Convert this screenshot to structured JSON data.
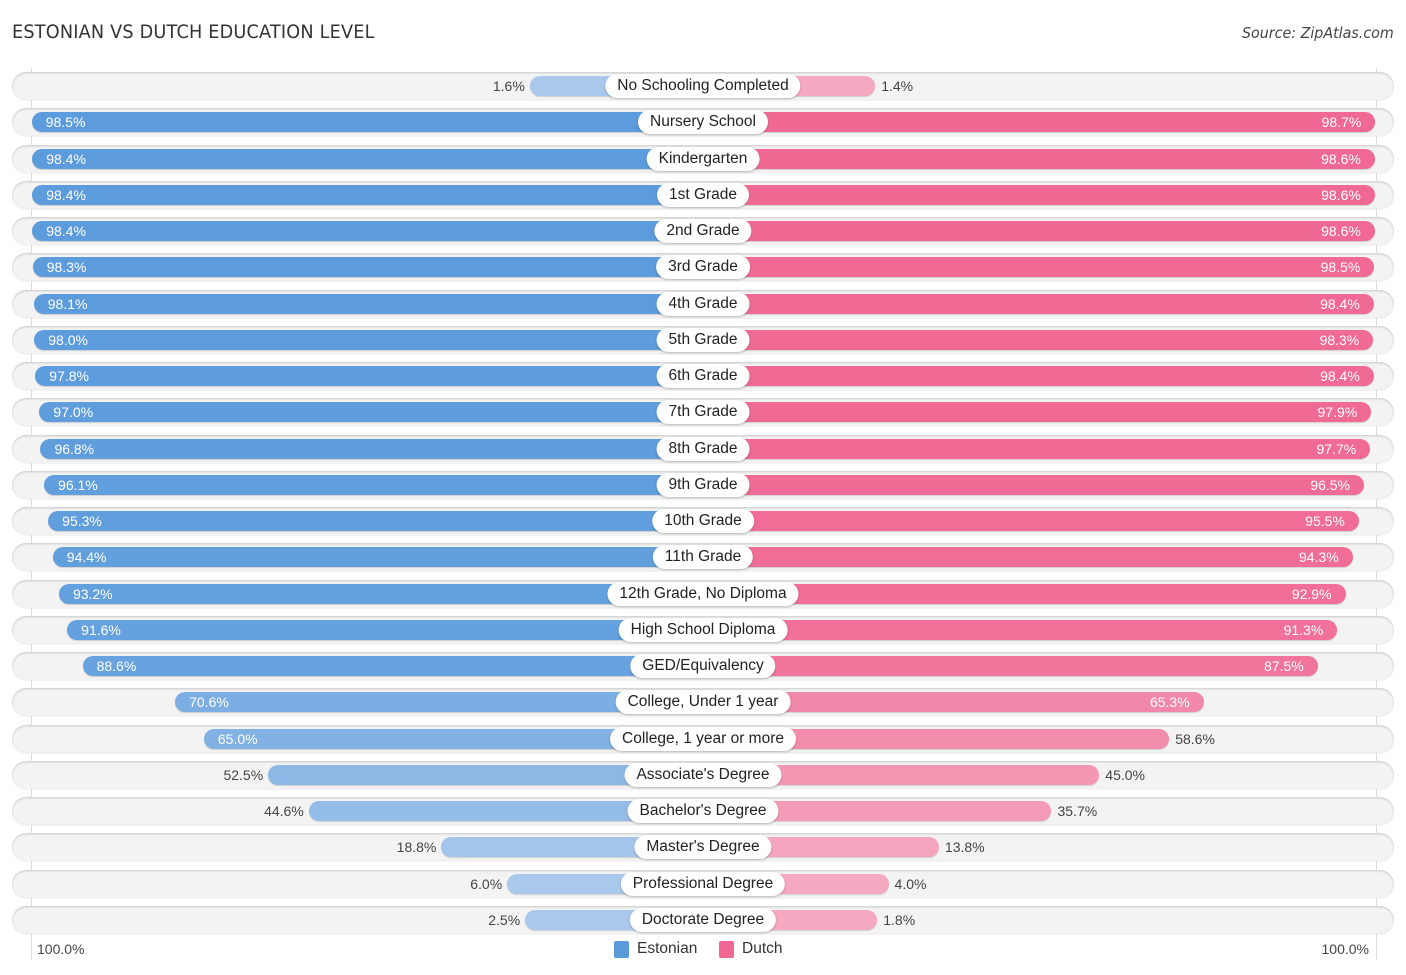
{
  "title": "ESTONIAN VS DUTCH EDUCATION LEVEL",
  "source": "Source: ZipAtlas.com",
  "colors": {
    "estonian_strong": "#5b9bdc",
    "estonian_light": "#a9c8ec",
    "dutch_strong": "#f06892",
    "dutch_light": "#f5a9c0"
  },
  "axis": {
    "left_label": "100.0%",
    "right_label": "100.0%"
  },
  "legend": [
    {
      "name": "Estonian",
      "color": "#5b9bdc"
    },
    {
      "name": "Dutch",
      "color": "#f06892"
    }
  ],
  "chart_data": {
    "type": "bar",
    "orientation": "horizontal-diverging",
    "title": "ESTONIAN VS DUTCH EDUCATION LEVEL",
    "xlabel": "",
    "ylabel": "",
    "xlim": [
      0,
      100
    ],
    "legend_position": "bottom-center",
    "categories": [
      "No Schooling Completed",
      "Nursery School",
      "Kindergarten",
      "1st Grade",
      "2nd Grade",
      "3rd Grade",
      "4th Grade",
      "5th Grade",
      "6th Grade",
      "7th Grade",
      "8th Grade",
      "9th Grade",
      "10th Grade",
      "11th Grade",
      "12th Grade, No Diploma",
      "High School Diploma",
      "GED/Equivalency",
      "College, Under 1 year",
      "College, 1 year or more",
      "Associate's Degree",
      "Bachelor's Degree",
      "Master's Degree",
      "Professional Degree",
      "Doctorate Degree"
    ],
    "series": [
      {
        "name": "Estonian",
        "side": "left",
        "values": [
          1.6,
          98.5,
          98.4,
          98.4,
          98.4,
          98.3,
          98.1,
          98.0,
          97.8,
          97.0,
          96.8,
          96.1,
          95.3,
          94.4,
          93.2,
          91.6,
          88.6,
          70.6,
          65.0,
          52.5,
          44.6,
          18.8,
          6.0,
          2.5
        ],
        "labels": [
          "1.6%",
          "98.5%",
          "98.4%",
          "98.4%",
          "98.4%",
          "98.3%",
          "98.1%",
          "98.0%",
          "97.8%",
          "97.0%",
          "96.8%",
          "96.1%",
          "95.3%",
          "94.4%",
          "93.2%",
          "91.6%",
          "88.6%",
          "70.6%",
          "65.0%",
          "52.5%",
          "44.6%",
          "18.8%",
          "6.0%",
          "2.5%"
        ]
      },
      {
        "name": "Dutch",
        "side": "right",
        "values": [
          1.4,
          98.7,
          98.6,
          98.6,
          98.6,
          98.5,
          98.4,
          98.3,
          98.4,
          97.9,
          97.7,
          96.5,
          95.5,
          94.3,
          92.9,
          91.3,
          87.5,
          65.3,
          58.6,
          45.0,
          35.7,
          13.8,
          4.0,
          1.8
        ],
        "labels": [
          "1.4%",
          "98.7%",
          "98.6%",
          "98.6%",
          "98.6%",
          "98.5%",
          "98.4%",
          "98.3%",
          "98.4%",
          "97.9%",
          "97.7%",
          "96.5%",
          "95.5%",
          "94.3%",
          "92.9%",
          "91.3%",
          "87.5%",
          "65.3%",
          "58.6%",
          "45.0%",
          "35.7%",
          "13.8%",
          "4.0%",
          "1.8%"
        ]
      }
    ]
  }
}
